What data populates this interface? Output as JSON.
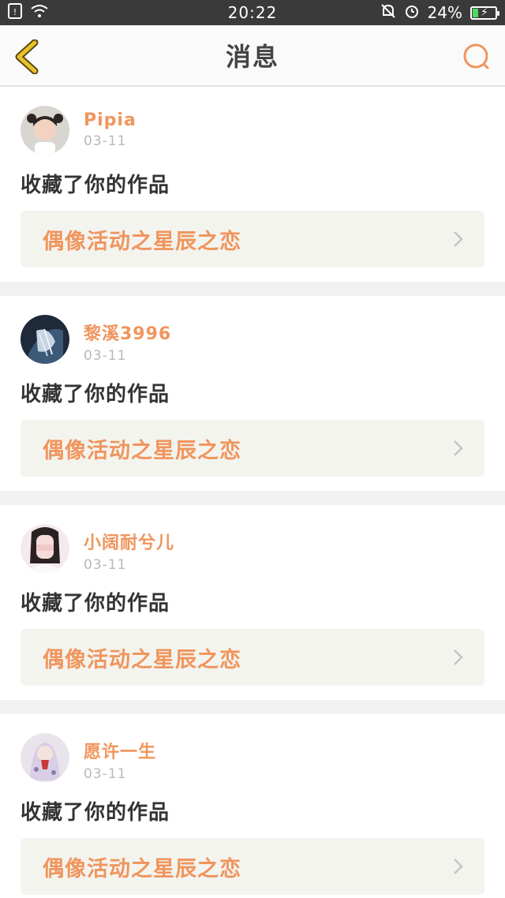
{
  "status_bar": {
    "time": "20:22",
    "battery_text": "24%",
    "battery_level": 0.24
  },
  "navbar": {
    "title": "消息"
  },
  "messages": [
    {
      "username": "Pipia",
      "date": "03-11",
      "action": "收藏了你的作品",
      "work_title": "偶像活动之星辰之恋"
    },
    {
      "username": "黎溪3996",
      "date": "03-11",
      "action": "收藏了你的作品",
      "work_title": "偶像活动之星辰之恋"
    },
    {
      "username": "小阔耐兮儿",
      "date": "03-11",
      "action": "收藏了你的作品",
      "work_title": "偶像活动之星辰之恋"
    },
    {
      "username": "愿许一生",
      "date": "03-11",
      "action": "收藏了你的作品",
      "work_title": "偶像活动之星辰之恋"
    }
  ],
  "colors": {
    "accent": "#f0955d",
    "back_arrow": "#e8c22e",
    "search": "#f0955d"
  }
}
